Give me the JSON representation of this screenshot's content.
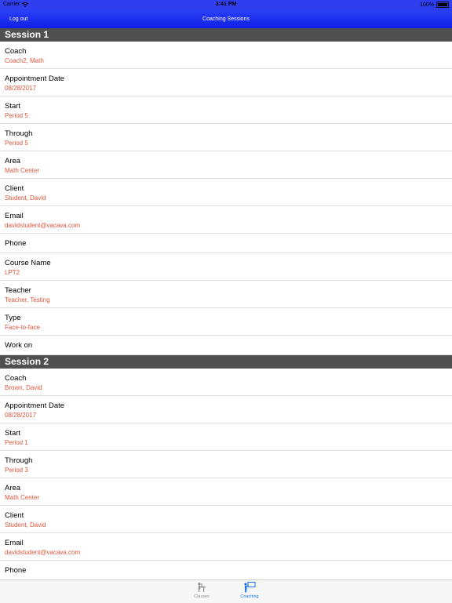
{
  "status_bar": {
    "carrier": "Carrier",
    "time": "3:41 PM",
    "battery": "100%"
  },
  "nav": {
    "left_button": "Log out",
    "title": "Coaching Sessions"
  },
  "sessions": [
    {
      "title": "Session 1",
      "fields": [
        {
          "label": "Coach",
          "value": "Coach2, Math"
        },
        {
          "label": "Appointment Date",
          "value": "08/28/2017"
        },
        {
          "label": "Start",
          "value": "Period 5"
        },
        {
          "label": "Through",
          "value": "Period 5"
        },
        {
          "label": "Area",
          "value": "Math Center"
        },
        {
          "label": "Client",
          "value": "Student, David"
        },
        {
          "label": "Email",
          "value": "davidstudent@vacava.com"
        },
        {
          "label": "Phone",
          "value": ""
        },
        {
          "label": "Course Name",
          "value": "LPT2"
        },
        {
          "label": "Teacher",
          "value": "Teacher, Testing"
        },
        {
          "label": "Type",
          "value": "Face-to-face"
        },
        {
          "label": "Work on",
          "value": ""
        }
      ]
    },
    {
      "title": "Session 2",
      "fields": [
        {
          "label": "Coach",
          "value": "Brown, David"
        },
        {
          "label": "Appointment Date",
          "value": "08/28/2017"
        },
        {
          "label": "Start",
          "value": "Period 1"
        },
        {
          "label": "Through",
          "value": "Period 3"
        },
        {
          "label": "Area",
          "value": "Math Center"
        },
        {
          "label": "Client",
          "value": "Student, David"
        },
        {
          "label": "Email",
          "value": "davidstudent@vacava.com"
        },
        {
          "label": "Phone",
          "value": ""
        }
      ]
    }
  ],
  "tabs": [
    {
      "label": "Classes",
      "icon": "classroom-icon",
      "selected": false
    },
    {
      "label": "Coaching",
      "icon": "teacher-board-icon",
      "selected": true
    }
  ],
  "colors": {
    "nav_bg": "#1a2ff0",
    "section_bg": "#505050",
    "value_text": "#e0553b",
    "tab_active": "#1a73e8"
  }
}
